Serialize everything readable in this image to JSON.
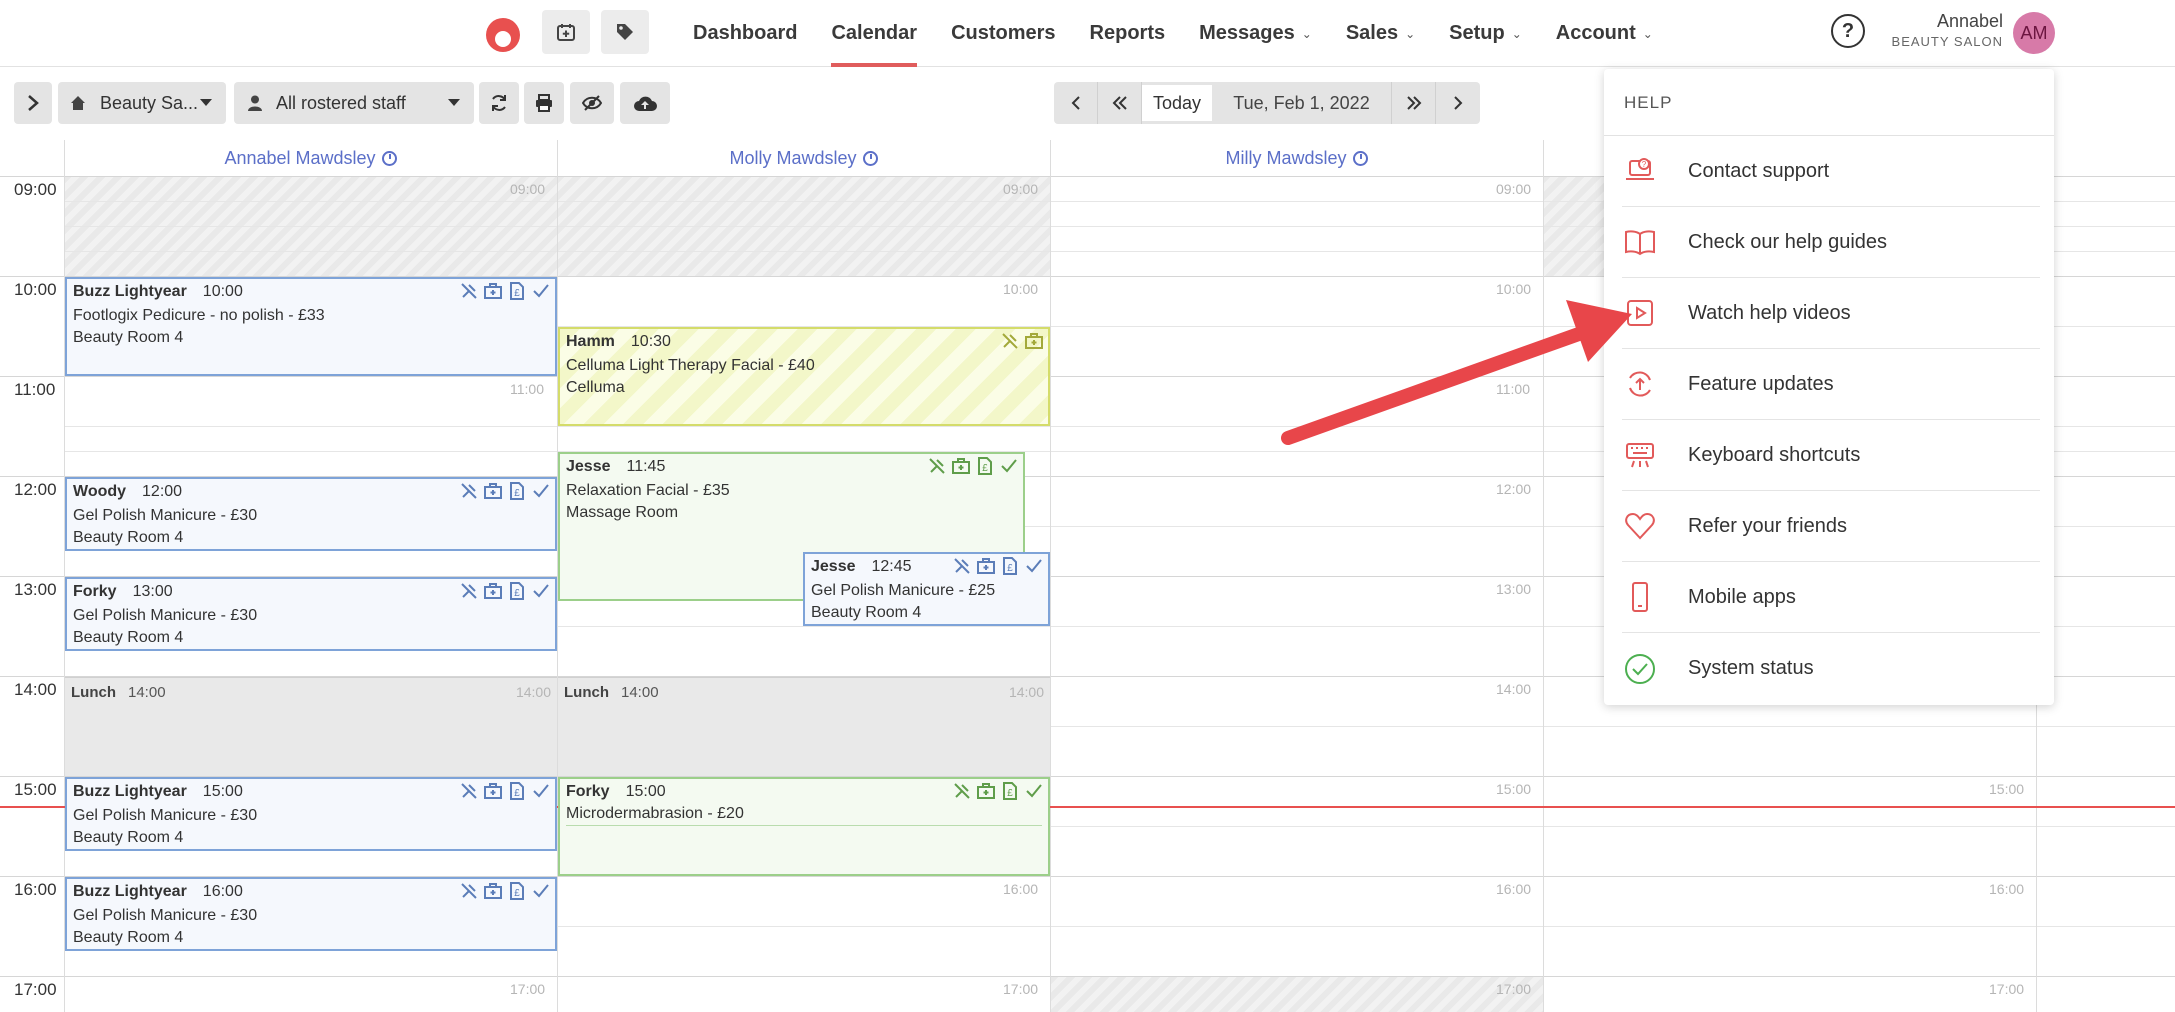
{
  "nav": {
    "items": [
      {
        "label": "Dashboard",
        "active": false,
        "dropdown": false
      },
      {
        "label": "Calendar",
        "active": true,
        "dropdown": false
      },
      {
        "label": "Customers",
        "active": false,
        "dropdown": false
      },
      {
        "label": "Reports",
        "active": false,
        "dropdown": false
      },
      {
        "label": "Messages",
        "active": false,
        "dropdown": true
      },
      {
        "label": "Sales",
        "active": false,
        "dropdown": true
      },
      {
        "label": "Setup",
        "active": false,
        "dropdown": true
      },
      {
        "label": "Account",
        "active": false,
        "dropdown": true
      }
    ],
    "caret": "⌄"
  },
  "user": {
    "name": "Annabel",
    "business": "BEAUTY SALON",
    "initials": "AM",
    "avatar_color": "#d77aa8"
  },
  "toolbar": {
    "location": "Beauty Sa...",
    "staff_filter": "All rostered staff",
    "today_label": "Today",
    "date": "Tue, Feb 1, 2022"
  },
  "staff": [
    "Annabel Mawdsley",
    "Molly Mawdsley",
    "Milly Mawdsley"
  ],
  "times": [
    "09:00",
    "10:00",
    "11:00",
    "12:00",
    "13:00",
    "14:00",
    "15:00",
    "16:00",
    "17:00"
  ],
  "lunch": {
    "label": "Lunch",
    "time": "14:00"
  },
  "appointments": {
    "buzz1": {
      "name": "Buzz Lightyear",
      "time": "10:00",
      "service": "Footlogix Pedicure - no polish - £33",
      "room": "Beauty Room 4"
    },
    "hamm": {
      "name": "Hamm",
      "time": "10:30",
      "service": "Celluma Light Therapy Facial - £40",
      "room": "Celluma"
    },
    "woody": {
      "name": "Woody",
      "time": "12:00",
      "service": "Gel Polish Manicure - £30",
      "room": "Beauty Room 4"
    },
    "jesse1": {
      "name": "Jesse",
      "time": "11:45",
      "service": "Relaxation Facial - £35",
      "room": "Massage Room"
    },
    "jesse2": {
      "name": "Jesse",
      "time": "12:45",
      "service": "Gel Polish Manicure - £25",
      "room": "Beauty Room 4"
    },
    "forky1": {
      "name": "Forky",
      "time": "13:00",
      "service": "Gel Polish Manicure - £30",
      "room": "Beauty Room 4"
    },
    "buzz2": {
      "name": "Buzz Lightyear",
      "time": "15:00",
      "service": "Gel Polish Manicure - £30",
      "room": "Beauty Room 4"
    },
    "forky2": {
      "name": "Forky",
      "time": "15:00",
      "service": "Microdermabrasion - £20",
      "room": ""
    },
    "buzz3": {
      "name": "Buzz Lightyear",
      "time": "16:00",
      "service": "Gel Polish Manicure - £30",
      "room": "Beauty Room 4"
    }
  },
  "help": {
    "title": "HELP",
    "items": [
      {
        "label": "Contact support",
        "icon": "support-laptop-icon"
      },
      {
        "label": "Check our help guides",
        "icon": "book-icon"
      },
      {
        "label": "Watch help videos",
        "icon": "video-play-icon"
      },
      {
        "label": "Feature updates",
        "icon": "refresh-upload-icon"
      },
      {
        "label": "Keyboard shortcuts",
        "icon": "keyboard-icon"
      },
      {
        "label": "Refer your friends",
        "icon": "heart-icon"
      },
      {
        "label": "Mobile apps",
        "icon": "mobile-phone-icon"
      },
      {
        "label": "System status",
        "icon": "check-circle-icon"
      }
    ]
  },
  "colors": {
    "accent": "#e05c5c",
    "staff_link": "#5b6fc8",
    "appt_blue": "#7ea3d8",
    "appt_green": "#9ccf8a",
    "appt_yellow": "#d4dc6a",
    "now_line": "#e8504f"
  }
}
